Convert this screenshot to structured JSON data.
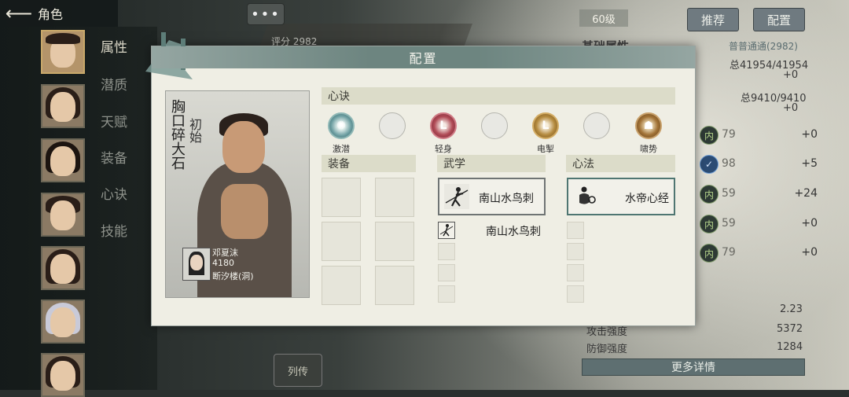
{
  "nav": {
    "back_icon": "arrow-left-icon",
    "title": "角色"
  },
  "sidebar": {
    "tabs": [
      {
        "label": "属性",
        "active": true
      },
      {
        "label": "潜质",
        "active": false
      },
      {
        "label": "天赋",
        "active": false
      },
      {
        "label": "装备",
        "active": false
      },
      {
        "label": "心诀",
        "active": false
      },
      {
        "label": "技能",
        "active": false
      }
    ]
  },
  "top": {
    "chat_label": "•••",
    "score_label": "评分",
    "score_value": "2982"
  },
  "right_panel": {
    "level": "60级",
    "recommend_label": "推荐",
    "config_label": "配置",
    "basic_attr_title": "基础属性",
    "basic_attr_sub": "普普通通(2982)",
    "total1": "总41954/41954",
    "total1_bonus": "+0",
    "total2": "总9410/9410",
    "total2_bonus": "+0",
    "stats": [
      {
        "icon": "内",
        "value": "79",
        "bonus": "+0",
        "tone": "green"
      },
      {
        "icon": "✓",
        "value": "98",
        "bonus": "+5",
        "tone": "blue"
      },
      {
        "icon": "内",
        "value": "59",
        "bonus": "+24",
        "tone": "green"
      },
      {
        "icon": "内",
        "value": "59",
        "bonus": "+0",
        "tone": "green"
      },
      {
        "icon": "内",
        "value": "79",
        "bonus": "+0",
        "tone": "green"
      }
    ],
    "extra_value": "2.23",
    "attack_label": "攻击强度",
    "attack_value": "5372",
    "defense_label": "防御强度",
    "defense_value": "1284",
    "more_label": "更多详情"
  },
  "biography_label": "列传",
  "modal": {
    "title": "配置",
    "card": {
      "title_main": "胸口碎大石",
      "title_sub": "初始",
      "owner_name": "邓夏沫",
      "owner_power": "4180",
      "owner_clan": "断汐楼(洞)"
    },
    "xinjue_header": "心诀",
    "xinjue_slots": [
      {
        "label": "激潜",
        "style": "teal",
        "glyph": "✺",
        "icon": "swirl-icon"
      },
      {
        "label": "",
        "style": "empty",
        "glyph": "",
        "icon": "empty-slot"
      },
      {
        "label": "轻身",
        "style": "red",
        "glyph": "L",
        "icon": "lightfoot-icon"
      },
      {
        "label": "",
        "style": "empty",
        "glyph": "",
        "icon": "empty-slot"
      },
      {
        "label": "电掣",
        "style": "gold",
        "glyph": "L",
        "icon": "lightning-icon"
      },
      {
        "label": "",
        "style": "empty",
        "glyph": "",
        "icon": "empty-slot"
      },
      {
        "label": "啸势",
        "style": "beast",
        "glyph": "☗",
        "icon": "beast-icon"
      }
    ],
    "equip_header": "装备",
    "martial_header": "武学",
    "mental_header": "心法",
    "martial_main": "南山水鸟刺",
    "martial_secondary": "南山水鸟刺",
    "mental_main": "水帝心经"
  }
}
